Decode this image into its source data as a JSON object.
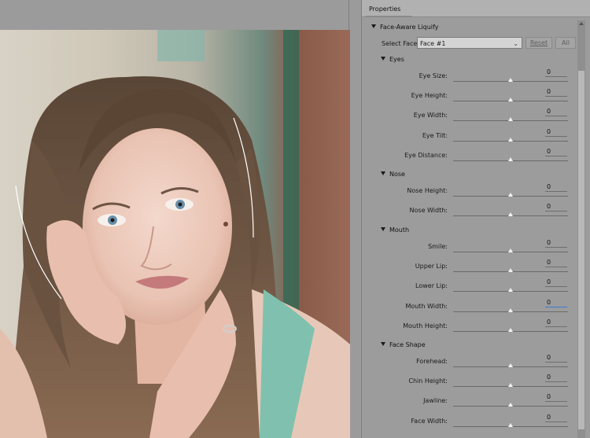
{
  "panel": {
    "title": "Properties",
    "section_title": "Face-Aware Liquify",
    "select_face_label": "Select Face:",
    "select_face_value": "Face #1",
    "reset_label": "Reset",
    "all_label": "All"
  },
  "groups": [
    {
      "title": "Eyes",
      "sliders": [
        {
          "label": "Eye Size:",
          "value": "0",
          "level": 0.5
        },
        {
          "label": "Eye Height:",
          "value": "0",
          "level": 0.5
        },
        {
          "label": "Eye Width:",
          "value": "0",
          "level": 0.5
        },
        {
          "label": "Eye Tilt:",
          "value": "0",
          "level": 0.5
        },
        {
          "label": "Eye Distance:",
          "value": "0",
          "level": 0.5
        }
      ]
    },
    {
      "title": "Nose",
      "sliders": [
        {
          "label": "Nose Height:",
          "value": "0",
          "level": 0.5
        },
        {
          "label": "Nose Width:",
          "value": "0",
          "level": 0.5
        }
      ]
    },
    {
      "title": "Mouth",
      "sliders": [
        {
          "label": "Smile:",
          "value": "0",
          "level": 0.5
        },
        {
          "label": "Upper Lip:",
          "value": "0",
          "level": 0.5
        },
        {
          "label": "Lower Lip:",
          "value": "0",
          "level": 0.5
        },
        {
          "label": "Mouth Width:",
          "value": "0",
          "level": 0.5,
          "active": true
        },
        {
          "label": "Mouth Height:",
          "value": "0",
          "level": 0.5
        }
      ]
    },
    {
      "title": "Face Shape",
      "sliders": [
        {
          "label": "Forehead:",
          "value": "0",
          "level": 0.5
        },
        {
          "label": "Chin Height:",
          "value": "0",
          "level": 0.5
        },
        {
          "label": "Jawline:",
          "value": "0",
          "level": 0.5
        },
        {
          "label": "Face Width:",
          "value": "0",
          "level": 0.5
        }
      ]
    }
  ],
  "icons": {
    "collapse": "triangle-down-icon",
    "dropdown": "chevron-down-icon"
  },
  "colors": {
    "panel_bg": "#9c9c9c",
    "slider_thumb": "#f2f2f2",
    "active_field": "#3a7bd5"
  }
}
